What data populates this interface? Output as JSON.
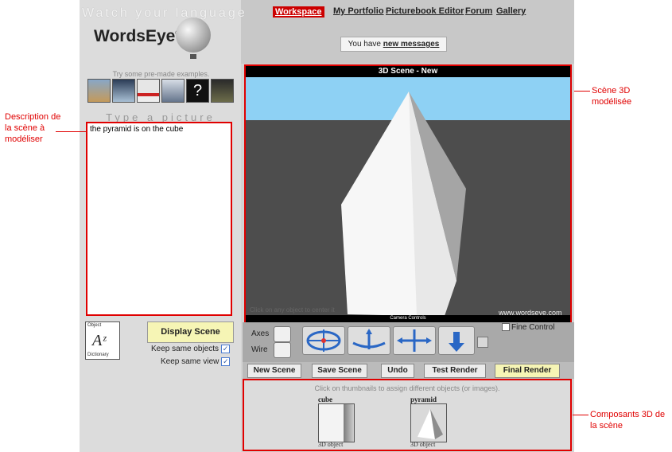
{
  "header": {
    "tagline": "Watch your language",
    "logo": "WordsEye",
    "logo_mark": "®"
  },
  "nav": {
    "items": [
      {
        "label": "Workspace",
        "active": true
      },
      {
        "label": "My Portfolio",
        "active": false
      },
      {
        "label": "Picturebook Editor",
        "active": false
      },
      {
        "label": "Forum",
        "active": false
      },
      {
        "label": "Gallery",
        "active": false
      }
    ]
  },
  "messages": {
    "prefix": "You have",
    "link": "new messages"
  },
  "examples": {
    "hint": "Try some pre-made examples.",
    "random_label": "?"
  },
  "input": {
    "heading": "Type a picture",
    "text": "the pyramid is on the cube"
  },
  "object_dictionary": {
    "top": "Object",
    "bottom": "Dictionary"
  },
  "display": {
    "button": "Display Scene",
    "keep_objects": "Keep same objects",
    "keep_view": "Keep same view"
  },
  "viewport": {
    "title": "3D Scene  -  New",
    "click_hint": "Click on any object to center it",
    "watermark": "www.wordseye.com",
    "camera_label": "Camera Controls"
  },
  "camera": {
    "axes_label": "Axes",
    "wire_label": "Wire",
    "fine_control": "Fine Control"
  },
  "actions": {
    "new_scene": "New Scene",
    "save_scene": "Save Scene",
    "undo": "Undo",
    "test_render": "Test Render",
    "final_render": "Final Render"
  },
  "thumbnails": {
    "hint": "Click on thumbnails to assign different objects (or images).",
    "items": [
      {
        "name": "cube",
        "type": "3D object"
      },
      {
        "name": "pyramid",
        "type": "3D object"
      }
    ]
  },
  "annotations": {
    "description": "Description de la scène à modéliser",
    "scene": "Scène 3D modélisée",
    "components": "Composants 3D de la scène"
  },
  "colors": {
    "accent_red": "#e00000",
    "sky": "#8ed1f4",
    "floor": "#4d4d4d",
    "highlight_yellow": "#f6f5b5"
  }
}
